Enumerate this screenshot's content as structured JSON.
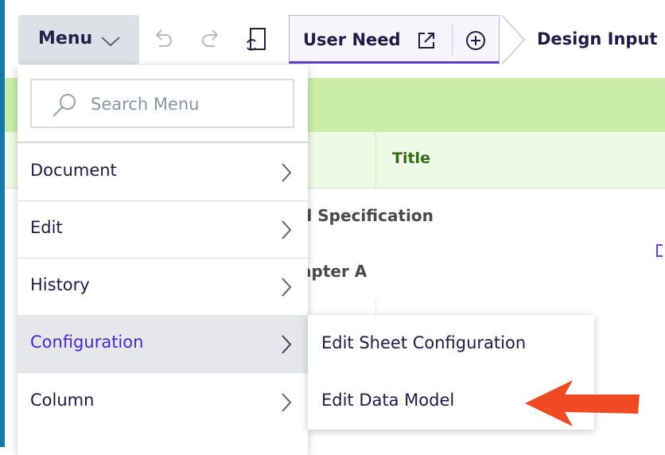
{
  "toolbar": {
    "menu_label": "Menu",
    "tabs": [
      {
        "label": "User Need"
      },
      {
        "label": "Design Input"
      }
    ]
  },
  "table": {
    "header_title": "Title",
    "rows": [
      {
        "text": "d Specification"
      },
      {
        "text": "apter A"
      }
    ]
  },
  "dropdown": {
    "search_placeholder": "Search Menu",
    "items": [
      {
        "label": "Document"
      },
      {
        "label": "Edit"
      },
      {
        "label": "History"
      },
      {
        "label": "Configuration"
      },
      {
        "label": "Column"
      }
    ],
    "active_item": "Configuration"
  },
  "submenu": {
    "items": [
      {
        "label": "Edit Sheet Configuration"
      },
      {
        "label": "Edit Data Model"
      }
    ]
  },
  "colors": {
    "accent": "#4a24d2",
    "green_band": "#caeea9",
    "annotation_arrow": "#ef4a23"
  },
  "icons": [
    "chevron-down-icon",
    "undo-icon",
    "redo-icon",
    "sync-sheet-icon",
    "external-link-icon",
    "add-circle-icon",
    "search-icon",
    "chevron-right-icon",
    "annotation-arrow"
  ]
}
